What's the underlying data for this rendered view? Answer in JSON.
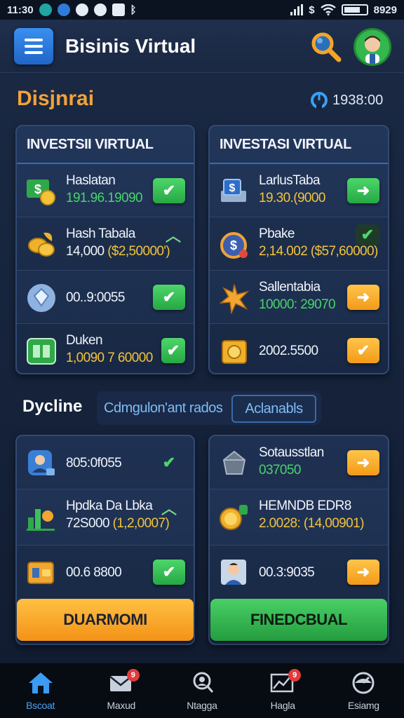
{
  "status_bar": {
    "time": "11:30",
    "right_text": "8929",
    "icons": [
      "notification-icon",
      "browser-icon",
      "sync-icon",
      "settings-icon",
      "gallery-icon",
      "bluetooth-icon",
      "signal-icon",
      "dollar-icon",
      "wifi-icon",
      "battery-icon"
    ]
  },
  "app_bar": {
    "title": "Bisinis Virtual",
    "menu_icon": "hamburger-icon",
    "search_icon": "search-icon",
    "avatar_icon": "avatar-icon"
  },
  "dashboard": {
    "title": "Disjnrai",
    "stat_value": "1938:00",
    "stat_icon": "gauge-icon"
  },
  "panel_left_top": {
    "title": "INVESTSII VIRTUAL",
    "rows": [
      {
        "name": "Haslatan",
        "value": "191.96.19090",
        "value_color": "green",
        "icon": "dollar-bill-icon",
        "action": "check"
      },
      {
        "name": "Hash Tabala",
        "value_a": "14,000",
        "value_b": "($2,50000')",
        "icon": "coins-icon",
        "action": "up"
      },
      {
        "name": "",
        "value": "00..9:0055",
        "icon": "diamond-icon",
        "action": "check"
      },
      {
        "name": "Duken",
        "value": "1,0090 7 60000",
        "value_color": "yellow",
        "icon": "chart-board-icon",
        "action": "check"
      }
    ]
  },
  "panel_right_top": {
    "title": "INVESTASI VIRTUAL",
    "rows": [
      {
        "name": "LarlusTaba",
        "value": "19.30.(9000",
        "value_color": "yellow",
        "icon": "cash-stack-icon",
        "action": "arrow"
      },
      {
        "name": "Pbake",
        "value": "2,14.002 ($57,60000)",
        "value_color": "yellow",
        "icon": "money-bag-icon",
        "action": "check"
      },
      {
        "name": "Sallentabia",
        "value": "10000: 29070",
        "value_color": "green",
        "icon": "star-burst-icon",
        "action": "arrow"
      },
      {
        "name": "",
        "value": "2002.5500",
        "icon": "gold-coin-icon",
        "action": "check"
      }
    ]
  },
  "mid_section": {
    "title": "Dycline",
    "field_text": "Cdmgulon'ant rados",
    "chip_label": "Aclanabls"
  },
  "panel_left_bottom": {
    "rows": [
      {
        "name": "",
        "value": "805:0f055",
        "icon": "person-card-icon",
        "action": "check-plain"
      },
      {
        "name": "Hpdka Da Lbka",
        "value_a": "72S000",
        "value_b": "(1,2,0007)",
        "icon": "bar-chart-icon",
        "action": "up-plain"
      },
      {
        "name": "",
        "value": "00.6 8800",
        "icon": "wallet-icon",
        "action": "check"
      }
    ],
    "button_label": "DUARMOMI"
  },
  "panel_right_bottom": {
    "rows": [
      {
        "name": "Sotausstlan",
        "value": "037050",
        "value_color": "green",
        "icon": "crystal-icon",
        "action": "arrow"
      },
      {
        "name": "HEMNDB EDR8",
        "value_a": "2.0028:",
        "value_b": "(14,00901)",
        "icon": "coin-stack-icon",
        "action": "arrow"
      },
      {
        "name": "",
        "value": "00.3:9035",
        "icon": "person-photo-icon",
        "action": "arrow"
      }
    ],
    "button_label": "FINEDCBUAL"
  },
  "bottom_nav": {
    "items": [
      {
        "label": "Bscoat",
        "icon": "home-icon",
        "badge": ""
      },
      {
        "label": "Maxud",
        "icon": "mail-icon",
        "badge": "9"
      },
      {
        "label": "Ntagga",
        "icon": "profile-search-icon",
        "badge": ""
      },
      {
        "label": "Hagla",
        "icon": "trend-chart-icon",
        "badge": "9"
      },
      {
        "label": "Esiamg",
        "icon": "settings-gauge-icon",
        "badge": ""
      }
    ]
  },
  "colors": {
    "accent_blue": "#2f7bd8",
    "accent_green": "#26a844",
    "accent_orange": "#f39a19",
    "title_orange": "#f2a23a"
  }
}
